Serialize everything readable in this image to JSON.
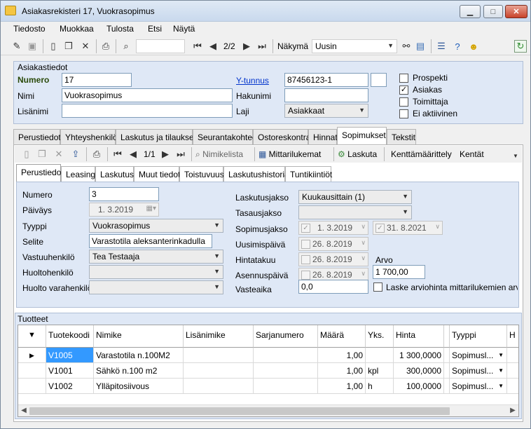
{
  "window": {
    "title": "Asiakasrekisteri 17, Vuokrasopimus"
  },
  "menu": [
    "Tiedosto",
    "Muokkaa",
    "Tulosta",
    "Etsi",
    "Näytä"
  ],
  "toolbar": {
    "record_pos": "2/2",
    "view_label": "Näkymä",
    "view_value": "Uusin"
  },
  "customer": {
    "section_title": "Asiakastiedot",
    "numero_label": "Numero",
    "numero_value": "17",
    "nimi_label": "Nimi",
    "nimi_value": "Vuokrasopimus",
    "lisanimi_label": "Lisänimi",
    "lisanimi_value": "",
    "ytunnus_label": "Y-tunnus",
    "ytunnus_value": "87456123-1",
    "hakunimi_label": "Hakunimi",
    "hakunimi_value": "",
    "laji_label": "Laji",
    "laji_value": "Asiakkaat",
    "flags": [
      {
        "label": "Prospekti",
        "checked": false
      },
      {
        "label": "Asiakas",
        "checked": true
      },
      {
        "label": "Toimittaja",
        "checked": false
      },
      {
        "label": "Ei aktiivinen",
        "checked": false
      }
    ]
  },
  "main_tabs": [
    "Perustiedot",
    "Yhteyshenkilöt",
    "Laskutus ja tilaukset",
    "Seurantakohteet",
    "Ostoreskontra",
    "Hinnat",
    "Sopimukset",
    "Tekstit"
  ],
  "sub_toolbar": {
    "record_pos": "1/1",
    "nimikelista": "Nimikelista",
    "mittarilukemat": "Mittarilukemat",
    "laskuta": "Laskuta",
    "kenttamaarittely": "Kenttämäärittely",
    "kentat": "Kentät"
  },
  "sub_tabs": [
    "Perustiedot",
    "Leasing",
    "Laskutus",
    "Muut tiedot",
    "Toistuvuus",
    "Laskutushistoria",
    "Tuntikiintiöt"
  ],
  "contract": {
    "numero_label": "Numero",
    "numero_value": "3",
    "paivays_label": "Päiväys",
    "paivays_value": "1. 3.2019",
    "tyyppi_label": "Tyyppi",
    "tyyppi_value": "Vuokrasopimus",
    "selite_label": "Selite",
    "selite_value": "Varastotila aleksanterinkadulla",
    "vastuuhenkilo_label": "Vastuuhenkilö",
    "vastuuhenkilo_value": "Tea Testaaja",
    "huoltohenkilo_label": "Huoltohenkilö",
    "huoltohenkilo_value": "",
    "huolto_varahenkilo_label": "Huolto varahenkilö",
    "huolto_varahenkilo_value": "",
    "laskutusjakso_label": "Laskutusjakso",
    "laskutusjakso_value": "Kuukausittain (1)",
    "tasausjakso_label": "Tasausjakso",
    "tasausjakso_value": "",
    "sopimusjakso_label": "Sopimusjakso",
    "sopimusjakso_start": "1. 3.2019",
    "sopimusjakso_end": "31. 8.2021",
    "uusimispaiva_label": "Uusimispäivä",
    "uusimispaiva_value": "26. 8.2019",
    "hintatakuu_label": "Hintatakuu",
    "hintatakuu_value": "26. 8.2019",
    "asennuspaiva_label": "Asennuspäivä",
    "asennuspaiva_value": "26. 8.2019",
    "arvo_label": "Arvo",
    "arvo_value": "1 700,00",
    "vasteaika_label": "Vasteaika",
    "vasteaika_value": "0,0",
    "laske_label": "Laske arviohinta mittarilukemien arvioist"
  },
  "products": {
    "title": "Tuotteet",
    "headers": [
      "Tuotekoodi",
      "Nimike",
      "Lisänimike",
      "Sarjanumero",
      "Määrä",
      "Yks.",
      "Hinta",
      "",
      "Tyyppi",
      "H"
    ],
    "rows": [
      {
        "code": "V1005",
        "name": "Varastotila n.100M2",
        "extra": "",
        "serial": "",
        "qty": "1,00",
        "unit": "",
        "price": "1 300,0000",
        "type": "Sopimusl..."
      },
      {
        "code": "V1001",
        "name": "Sähkö n.100 m2",
        "extra": "",
        "serial": "",
        "qty": "1,00",
        "unit": "kpl",
        "price": "300,0000",
        "type": "Sopimusl..."
      },
      {
        "code": "V1002",
        "name": "Ylläpitosiivous",
        "extra": "",
        "serial": "",
        "qty": "1,00",
        "unit": "h",
        "price": "100,0000",
        "type": "Sopimusl..."
      }
    ]
  },
  "colors": {
    "panel": "#dfe8f6",
    "selected_cell": "#3399ff"
  }
}
